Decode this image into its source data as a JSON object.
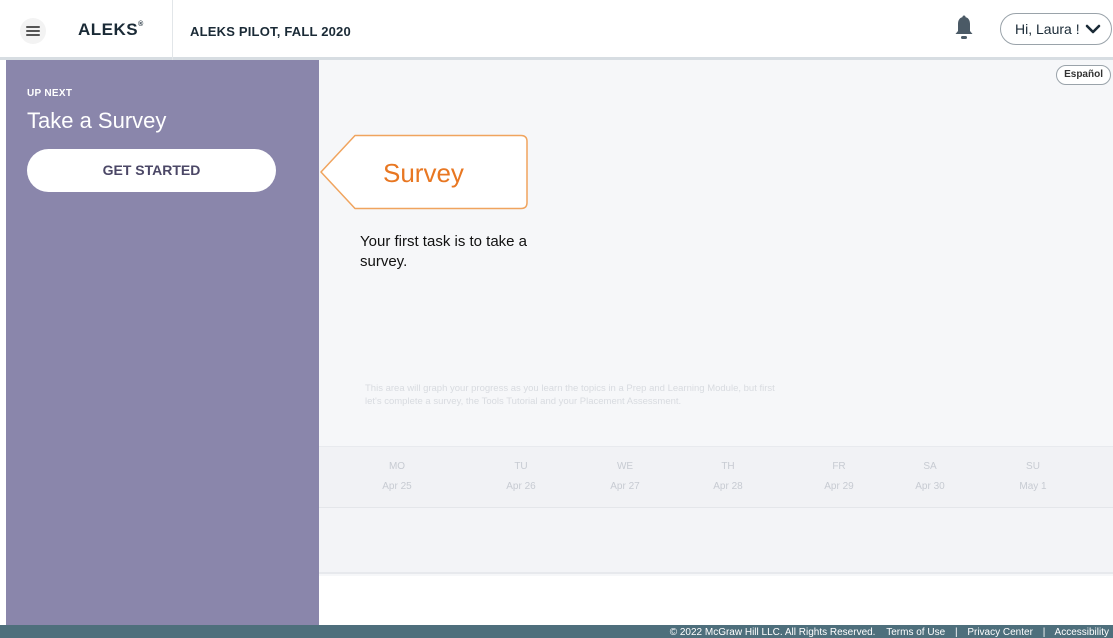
{
  "header": {
    "logo": "ALEKS",
    "logo_mark": "®",
    "class_name": "ALEKS PILOT, FALL 2020",
    "user_greeting": "Hi, Laura !"
  },
  "sidebar": {
    "eyebrow": "UP NEXT",
    "title": "Take a Survey",
    "button_label": "GET STARTED"
  },
  "main": {
    "language_button": "Español",
    "task_label": "Survey",
    "task_description": "Your first task is to take a survey.",
    "graph_note": "This area will graph your progress as you learn the topics in a Prep and Learning Module, but first let's complete a survey, the Tools Tutorial and your Placement Assessment.",
    "days": [
      {
        "dow": "MO",
        "date": "Apr 25"
      },
      {
        "dow": "TU",
        "date": "Apr 26"
      },
      {
        "dow": "WE",
        "date": "Apr 27"
      },
      {
        "dow": "TH",
        "date": "Apr 28"
      },
      {
        "dow": "FR",
        "date": "Apr 29"
      },
      {
        "dow": "SA",
        "date": "Apr 30"
      },
      {
        "dow": "SU",
        "date": "May 1"
      }
    ]
  },
  "footer": {
    "copyright": "© 2022 McGraw Hill LLC. All Rights Reserved.",
    "terms": "Terms of Use",
    "privacy": "Privacy Center",
    "accessibility": "Accessibility",
    "separator": "|"
  },
  "colors": {
    "sidebar_bg": "#8a86ab",
    "accent_orange": "#e87722",
    "footer_bg": "#4e6f7c"
  },
  "icons": {
    "menu": "hamburger-menu-icon",
    "notifications": "bell-icon",
    "user_menu": "chevron-down-icon"
  }
}
